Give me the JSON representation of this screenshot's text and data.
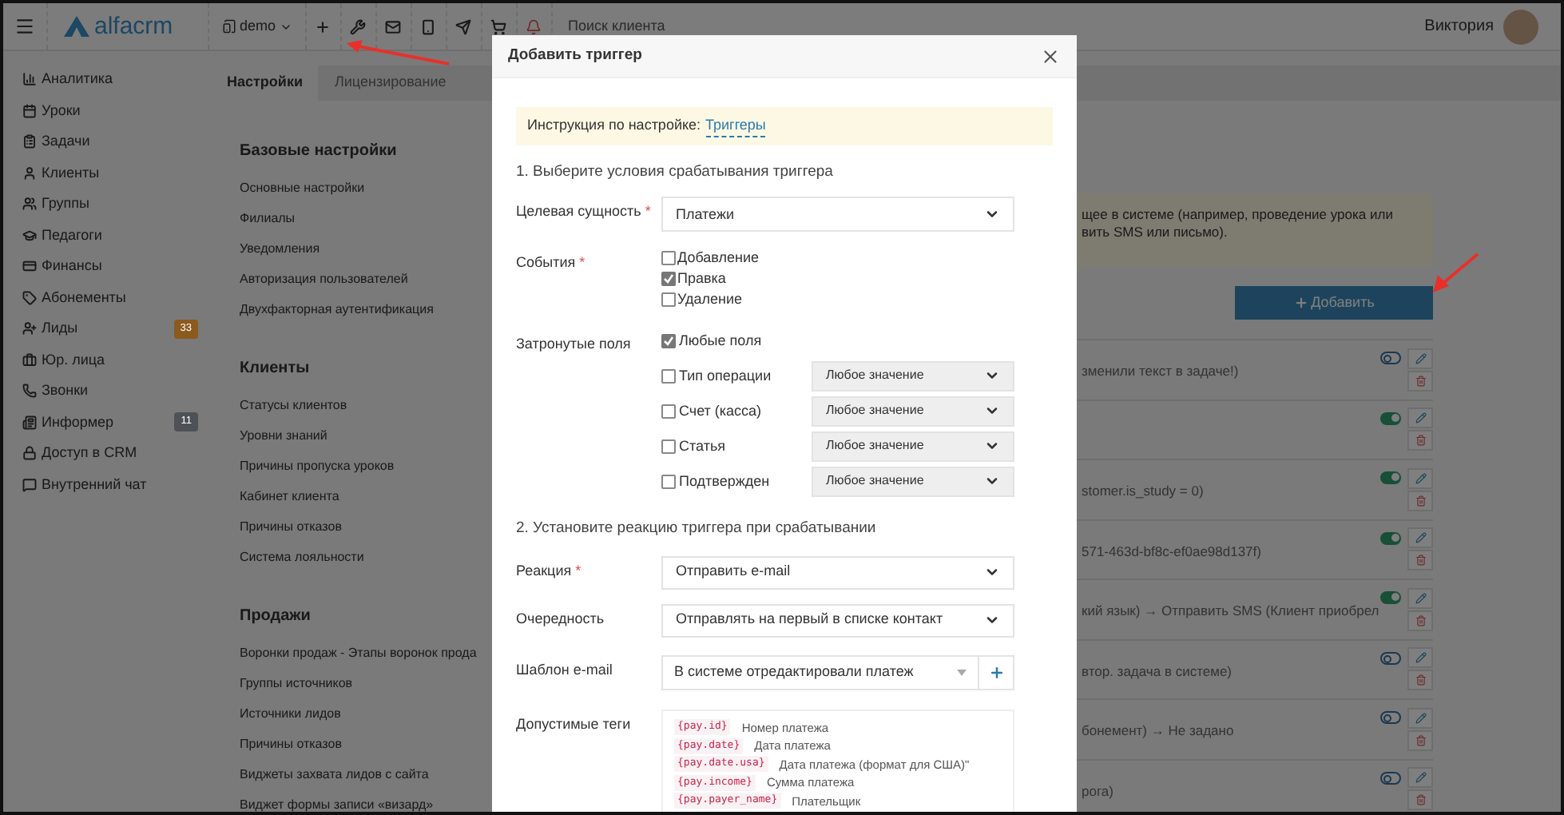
{
  "header": {
    "logo": "alfacrm",
    "branch": "demo",
    "search_placeholder": "Поиск клиента",
    "user": "Виктория"
  },
  "sidebar": {
    "items": [
      {
        "label": "Аналитика"
      },
      {
        "label": "Уроки"
      },
      {
        "label": "Задачи"
      },
      {
        "label": "Клиенты"
      },
      {
        "label": "Группы"
      },
      {
        "label": "Педагоги"
      },
      {
        "label": "Финансы"
      },
      {
        "label": "Абонементы"
      },
      {
        "label": "Лиды",
        "badge": "33",
        "color": "#8a5a1f"
      },
      {
        "label": "Юр. лица"
      },
      {
        "label": "Звонки"
      },
      {
        "label": "Информер",
        "badge": "11",
        "color": "#4d5257"
      },
      {
        "label": "Доступ в CRM"
      },
      {
        "label": "Внутренний чат"
      }
    ]
  },
  "tabs": [
    {
      "label": "Настройки",
      "selected": true
    },
    {
      "label": "Лицензирование",
      "selected": false
    }
  ],
  "settings_sections": [
    {
      "title": "Базовые настройки",
      "items": [
        "Основные настройки",
        "Филиалы",
        "Уведомления",
        "Авторизация пользователей",
        "Двухфакторная аутентификация"
      ]
    },
    {
      "title": "Клиенты",
      "items": [
        "Статусы клиентов",
        "Уровни знаний",
        "Причины пропуска уроков",
        "Кабинет клиента",
        "Причины отказов",
        "Система лояльности"
      ]
    },
    {
      "title": "Продажи",
      "items": [
        "Воронки продаж - Этапы воронок прода",
        "Группы источников",
        "Источники лидов",
        "Причины отказов",
        "Виджеты захвата лидов с сайта",
        "Виджет формы записи «визард»"
      ]
    }
  ],
  "info_banner": {
    "lines": [
      "щее в системе (например, проведение урока или",
      "вить SMS или письмо)."
    ]
  },
  "add_button": "Добавить",
  "triggers": [
    {
      "text": "зменили текст в задаче!)",
      "on": false
    },
    {
      "on": true
    },
    {
      "text": "stomer.is_study = 0)",
      "on": true
    },
    {
      "text": "571-463d-bf8c-ef0ae98d137f)",
      "on": true
    },
    {
      "text": "кий язык) → Отправить SMS (Клиент приобрел",
      "on": true
    },
    {
      "text": "втор. задача в системе)",
      "on": false
    },
    {
      "text": "бонемент) → Не задано",
      "on": false
    },
    {
      "text": "рога)",
      "on": false
    }
  ],
  "modal": {
    "title": "Добавить триггер",
    "instruction": {
      "label": "Инструкция по настройке:",
      "link": "Триггеры"
    },
    "section_1": "1. Выберите условия срабатывания триггера",
    "target": {
      "label": "Целевая сущность",
      "mark": "*",
      "value": "Платежи"
    },
    "events": {
      "label": "События",
      "mark": "*",
      "options": [
        {
          "label": "Добавление",
          "checked": false
        },
        {
          "label": "Правка",
          "checked": true
        },
        {
          "label": "Удаление",
          "checked": false
        }
      ]
    },
    "affected": {
      "label": "Затронутые поля",
      "any": {
        "label": "Любые поля",
        "checked": true
      },
      "fields": [
        {
          "label": "Тип операции",
          "checked": false,
          "value": "Любое значение"
        },
        {
          "label": "Счет (касса)",
          "checked": false,
          "value": "Любое значение"
        },
        {
          "label": "Статья",
          "checked": false,
          "value": "Любое значение"
        },
        {
          "label": "Подтвержден",
          "checked": false,
          "value": "Любое значение"
        }
      ]
    },
    "section_2": "2. Установите реакцию триггера при срабатывании",
    "reaction": {
      "label": "Реакция",
      "mark": "*",
      "value": "Отправить e-mail"
    },
    "order": {
      "label": "Очередность",
      "value": "Отправлять на первый в списке контакт"
    },
    "template": {
      "label": "Шаблон e-mail",
      "value": "В системе отредактировали платеж"
    },
    "tags": {
      "label": "Допустимые теги",
      "items": [
        {
          "tag": "{pay.id}",
          "description": "Номер платежа"
        },
        {
          "tag": "{pay.date}",
          "description": "Дата платежа"
        },
        {
          "tag": "{pay.date.usa}",
          "description": "Дата платежа (формат для США)\""
        },
        {
          "tag": "{pay.income}",
          "description": "Сумма платежа"
        },
        {
          "tag": "{pay.payer_name}",
          "description": "Плательщик"
        }
      ]
    }
  }
}
